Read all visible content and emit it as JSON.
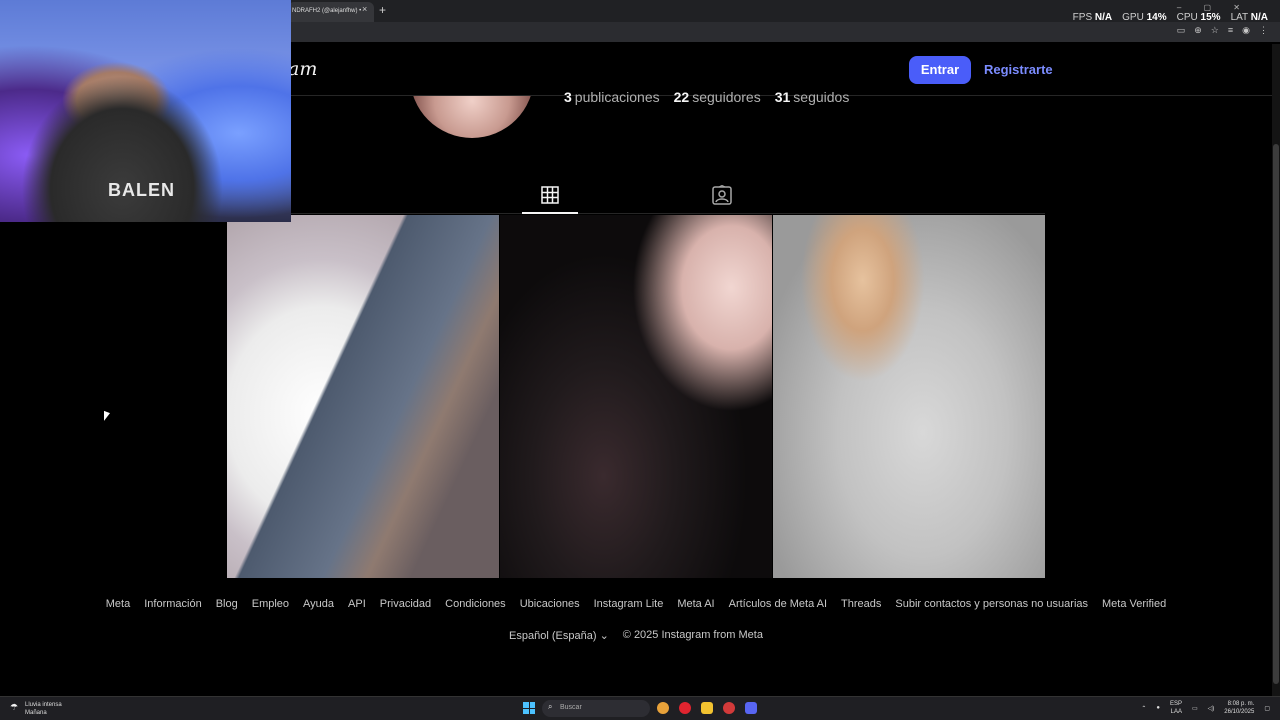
{
  "browser": {
    "tab_title": "NDRAFH2 (@alejanfhw) •",
    "tab_close": "×",
    "new_tab": "+",
    "stats": {
      "fps_label": "FPS",
      "fps_value": "N/A",
      "gpu_label": "GPU",
      "gpu_value": "14",
      "gpu_unit": "%",
      "cpu_label": "CPU",
      "cpu_value": "15",
      "cpu_unit": "%",
      "lat_label": "LAT",
      "lat_value": "N/A"
    }
  },
  "header": {
    "logo_text": "am",
    "login_label": "Entrar",
    "signup_label": "Registrarte"
  },
  "profile": {
    "posts_count": "3",
    "posts_label": "publicaciones",
    "followers_count": "22",
    "followers_label": "seguidores",
    "following_count": "31",
    "following_label": "seguidos"
  },
  "footer": {
    "links": [
      "Meta",
      "Información",
      "Blog",
      "Empleo",
      "Ayuda",
      "API",
      "Privacidad",
      "Condiciones",
      "Ubicaciones",
      "Instagram Lite",
      "Meta AI",
      "Artículos de Meta AI",
      "Threads",
      "Subir contactos y personas no usuarias",
      "Meta Verified"
    ],
    "language": "Español (España)",
    "copyright": "© 2025 Instagram from Meta"
  },
  "webcam": {
    "shirt_text": "BALEN"
  },
  "taskbar": {
    "weather_title": "Lluvia intensa",
    "weather_sub": "Mañana",
    "search_placeholder": "Buscar",
    "lang_top": "ESP",
    "lang_bottom": "LAA",
    "time": "8:08 p. m.",
    "date": "26/10/2025"
  },
  "colors": {
    "accent": "#4a5df9",
    "link": "#7b8cff",
    "background": "#000000"
  }
}
